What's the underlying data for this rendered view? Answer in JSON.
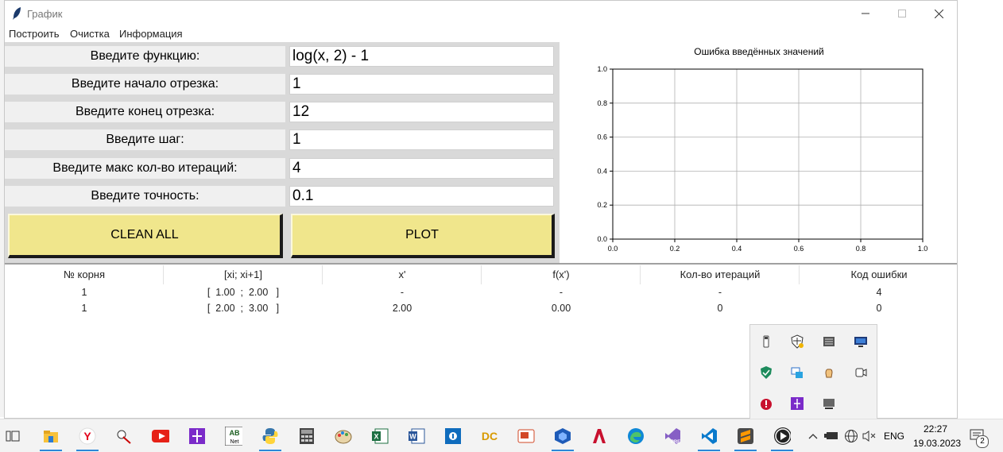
{
  "window": {
    "title": "График"
  },
  "menu": [
    "Построить",
    "Очистка",
    "Информация"
  ],
  "form": {
    "fields": [
      {
        "label": "Введите функцию:",
        "value": "log(x, 2) - 1"
      },
      {
        "label": "Введите начало отрезка:",
        "value": "1"
      },
      {
        "label": "Введите конец отрезка:",
        "value": "12"
      },
      {
        "label": "Введите шаг:",
        "value": "1"
      },
      {
        "label": "Введите макс кол-во итераций:",
        "value": "4"
      },
      {
        "label": "Введите точность:",
        "value": "0.1"
      }
    ],
    "clean_label": "CLEAN ALL",
    "plot_label": "PLOT",
    "button_color": "#f0e68c"
  },
  "chart_data": {
    "type": "line",
    "title": "Ошибка введённых значений",
    "xlabel": "",
    "ylabel": "",
    "series": [],
    "xlim": [
      0.0,
      1.0
    ],
    "ylim": [
      0.0,
      1.0
    ],
    "xticks": [
      "0.0",
      "0.2",
      "0.4",
      "0.6",
      "0.8",
      "1.0"
    ],
    "yticks": [
      "0.0",
      "0.2",
      "0.4",
      "0.6",
      "0.8",
      "1.0"
    ],
    "grid": true
  },
  "table": {
    "headers": [
      "№ корня",
      "[xi; xi+1]",
      "x'",
      "f(x')",
      "Кол-во итераций",
      "Код ошибки"
    ],
    "rows": [
      [
        "1",
        "[  1.00  ;  2.00   ]",
        "-",
        "-",
        "-",
        "4"
      ],
      [
        "1",
        "[  2.00  ;  3.00   ]",
        "2.00",
        "0.00",
        "0",
        "0"
      ]
    ]
  },
  "taskbar": {
    "lang": "ENG",
    "time": "22:27",
    "date": "19.03.2023",
    "notifications": "2",
    "apps": [
      "task-view",
      "file-explorer",
      "yandex-browser",
      "snipping",
      "youtube",
      "paint-tool",
      "abbyy-lingvo",
      "python",
      "calculator",
      "paint",
      "excel",
      "word",
      "app-blue",
      "vscode-dc",
      "adobe",
      "virtualbox",
      "autocad",
      "edge",
      "visual-studio",
      "vscode",
      "sublime",
      "media-player"
    ]
  },
  "tray_icons": [
    "usb-icon",
    "security-warning-icon",
    "keyboard-icon",
    "monitor-icon",
    "defender-icon",
    "sync-icon",
    "hand-icon",
    "camera-icon",
    "alert-icon",
    "tool-icon",
    "display-icon"
  ]
}
